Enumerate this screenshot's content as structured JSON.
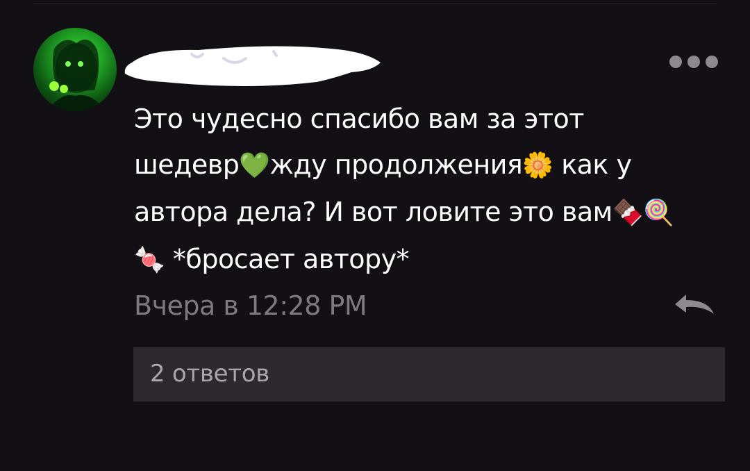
{
  "comment": {
    "text_line1": "Это чудесно спасибо вам за этот",
    "text_line2_a": "шедевр",
    "emoji_heart": "💚",
    "text_line2_b": "жду продолжения",
    "emoji_flower": "🌼",
    "text_line2_c": " как у",
    "text_line3": "автора дела? И вот ловите это вам",
    "emoji_chocolate": "🍫",
    "emoji_lollipop": "🍭",
    "emoji_candy": "🍬",
    "text_line4": " *бросает автору*",
    "timestamp": "Вчера в 12:28 PM"
  },
  "replies": {
    "label": "2 ответов"
  },
  "icons": {
    "more": "more-dots-icon",
    "reply": "reply-arrow-icon",
    "avatar": "user-avatar"
  },
  "colors": {
    "background": "#121014",
    "text": "#ffffff",
    "muted": "#7d7b80",
    "replies_bg": "#2c2a2e",
    "avatar_accent": "#3fe03a"
  }
}
